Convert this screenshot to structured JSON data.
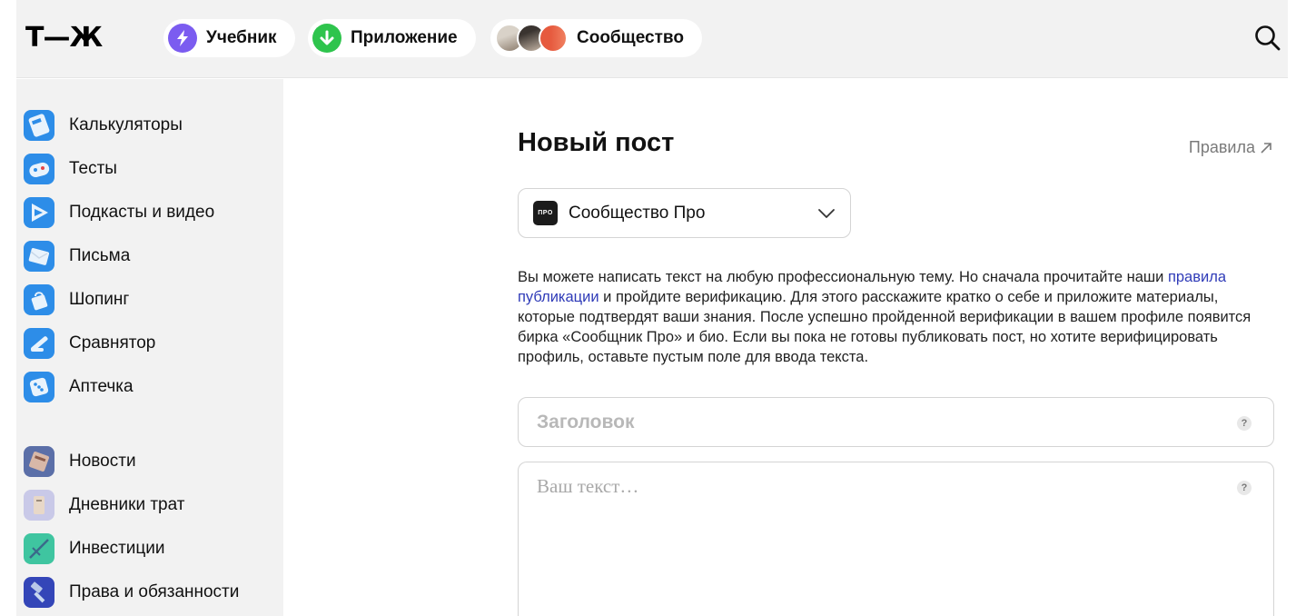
{
  "header": {
    "logo": "Т—Ж",
    "pills": [
      {
        "label": "Учебник",
        "icon": "lightning-icon",
        "color": "#7b5cf0"
      },
      {
        "label": "Приложение",
        "icon": "download-arrow-icon",
        "color": "#2ec44d"
      },
      {
        "label": "Сообщество",
        "icon": "avatars-icon"
      }
    ],
    "search_icon": "search-icon"
  },
  "sidebar": {
    "items": [
      {
        "label": "Калькуляторы",
        "icon": "calculator-icon"
      },
      {
        "label": "Тесты",
        "icon": "gamepad-icon"
      },
      {
        "label": "Подкасты и видео",
        "icon": "play-icon"
      },
      {
        "label": "Письма",
        "icon": "envelope-icon"
      },
      {
        "label": "Шопинг",
        "icon": "shopping-icon"
      },
      {
        "label": "Сравнятор",
        "icon": "compare-icon"
      },
      {
        "label": "Аптечка",
        "icon": "dice-icon"
      },
      {
        "label": "Новости",
        "icon": "news-icon"
      },
      {
        "label": "Дневники трат",
        "icon": "diary-icon"
      },
      {
        "label": "Инвестиции",
        "icon": "investments-icon"
      },
      {
        "label": "Права и обязанности",
        "icon": "hammer-icon"
      }
    ]
  },
  "main": {
    "title": "Новый пост",
    "rules_link": "Правила",
    "dropdown": {
      "logo_text": "ПРО",
      "value": "Сообщество Про"
    },
    "description": {
      "part1": "Вы можете написать текст на любую профессиональную тему. Но сначала прочитайте наши ",
      "link": "правила публикации",
      "part2": " и пройдите верификацию. Для этого расскажите кратко о себе и приложите материалы, которые подтвердят ваши знания. После успешно пройденной верификации в вашем профиле появится бирка «Сообщник Про» и био. Если вы пока не готовы публиковать пост, но хотите верифицировать профиль, оставьте пустым поле для ввода текста."
    },
    "title_field": {
      "placeholder": "Заголовок",
      "help": "?"
    },
    "body_field": {
      "placeholder": "Ваш текст…",
      "help": "?"
    }
  },
  "colors": {
    "accent_link": "#2f3bb8",
    "sidebar_bg": "#f2f2f2",
    "icon_blue": "#2d8de8"
  }
}
